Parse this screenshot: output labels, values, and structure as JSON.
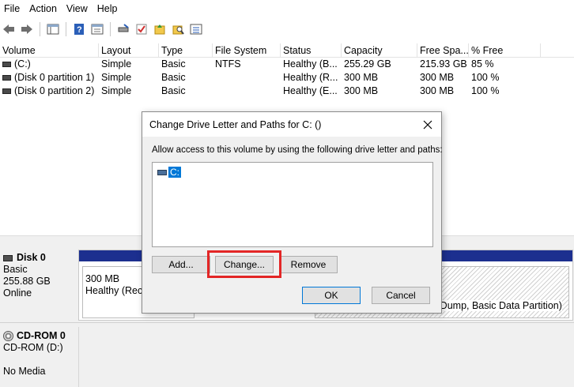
{
  "menu": [
    "File",
    "Action",
    "View",
    "Help"
  ],
  "table": {
    "columns": [
      "Volume",
      "Layout",
      "Type",
      "File System",
      "Status",
      "Capacity",
      "Free Spa...",
      "% Free"
    ],
    "rows": [
      [
        "(C:)",
        "Simple",
        "Basic",
        "NTFS",
        "Healthy (B...",
        "255.29 GB",
        "215.93 GB",
        "85 %"
      ],
      [
        "(Disk 0 partition 1)",
        "Simple",
        "Basic",
        "",
        "Healthy (R...",
        "300 MB",
        "300 MB",
        "100 %"
      ],
      [
        "(Disk 0 partition 2)",
        "Simple",
        "Basic",
        "",
        "Healthy (E...",
        "300 MB",
        "300 MB",
        "100 %"
      ]
    ]
  },
  "disks": {
    "disk0": {
      "name": "Disk 0",
      "type": "Basic",
      "size": "255.88 GB",
      "state": "Online"
    },
    "partition1": {
      "size": "300 MB",
      "status": "Healthy (Reco"
    },
    "partition3": {
      "status": "sh Dump, Basic Data Partition)"
    },
    "cdrom": {
      "name": "CD-ROM 0",
      "drive": "CD-ROM (D:)",
      "state": "No Media"
    }
  },
  "dialog": {
    "title": "Change Drive Letter and Paths for C: ()",
    "description": "Allow access to this volume by using the following drive letter and paths:",
    "list_item": "C:",
    "add_label": "Add...",
    "change_label": "Change...",
    "remove_label": "Remove",
    "ok_label": "OK",
    "cancel_label": "Cancel"
  },
  "colors": {
    "selection": "#0078d7",
    "disk_bar": "#1c2f8f",
    "highlight": "#e32626"
  }
}
